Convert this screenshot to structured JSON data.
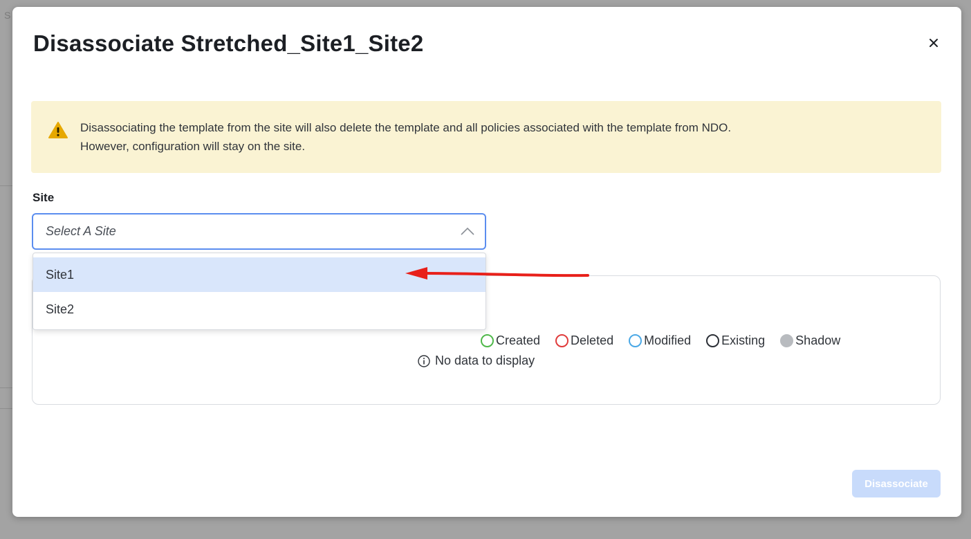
{
  "backdrop": {
    "letter": "S"
  },
  "modal": {
    "title": "Disassociate Stretched_Site1_Site2",
    "close_label": "×"
  },
  "warning": {
    "icon": "warning-triangle-icon",
    "line1": "Disassociating the template from the site will also delete the template and all policies associated with the template from NDO.",
    "line2": "However, configuration will stay on the site."
  },
  "site_field": {
    "label": "Site",
    "placeholder": "Select A Site",
    "options": [
      "Site1",
      "Site2"
    ],
    "highlighted_option": "Site1"
  },
  "legend": {
    "items": [
      {
        "label": "Created",
        "color": "#4fb84a",
        "style": "outline"
      },
      {
        "label": "Deleted",
        "color": "#e03b3b",
        "style": "outline"
      },
      {
        "label": "Modified",
        "color": "#4aa8e6",
        "style": "outline"
      },
      {
        "label": "Existing",
        "color": "#2b2f36",
        "style": "outline"
      },
      {
        "label": "Shadow",
        "color": "#b8bbbf",
        "style": "filled"
      }
    ]
  },
  "empty_state": {
    "text": "No data to display"
  },
  "footer": {
    "primary_label": "Disassociate",
    "primary_disabled": true
  },
  "colors": {
    "accent": "#5b8def",
    "warning_bg": "#faf3d3",
    "annotation_arrow": "#e8201a"
  }
}
